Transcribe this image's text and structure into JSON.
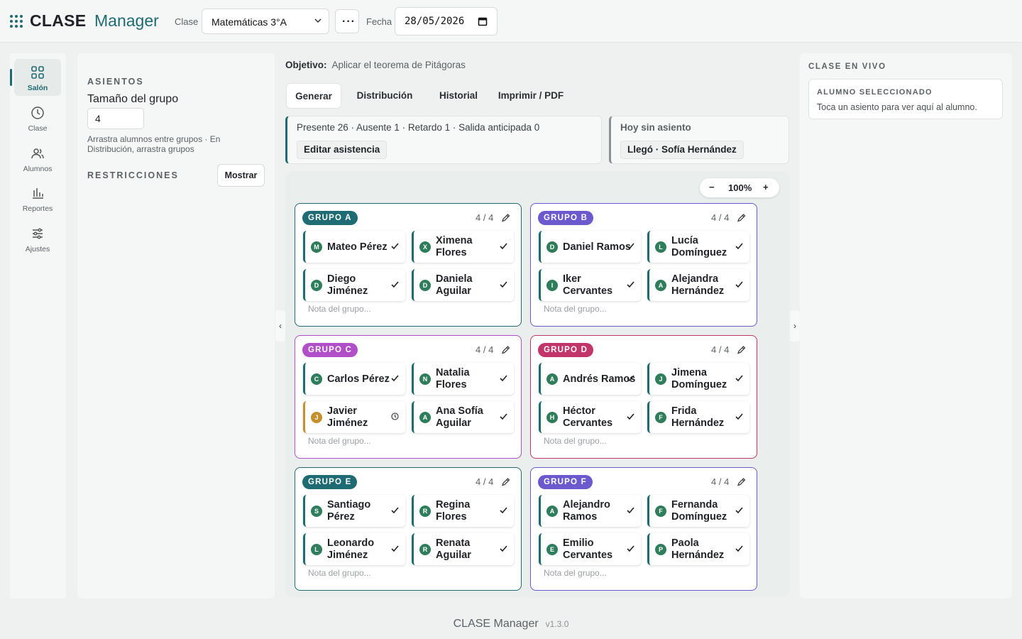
{
  "header": {
    "brand_bold": "CLASE",
    "brand_light": "Manager",
    "class_label": "Clase",
    "class_value": "Matemáticas 3°A",
    "more_icon": "more-horizontal-icon",
    "date_label": "Fecha",
    "date_value": "28/05/2026"
  },
  "nav": {
    "items": [
      {
        "label": "Salón",
        "icon": "grid-icon"
      },
      {
        "label": "Clase",
        "icon": "clock-icon"
      },
      {
        "label": "Alumnos",
        "icon": "users-icon"
      },
      {
        "label": "Reportes",
        "icon": "bar-chart-icon"
      },
      {
        "label": "Ajustes",
        "icon": "sliders-icon"
      }
    ]
  },
  "left_panel": {
    "seats_heading": "ASIENTOS",
    "group_size_label": "Tamaño del grupo",
    "group_size_value": "4",
    "hint": "Arrastra alumnos entre grupos · En Distribución, arrastra grupos",
    "restrictions_heading": "RESTRICCIONES",
    "show_button": "Mostrar"
  },
  "main": {
    "objective_label": "Objetivo:",
    "objective_text": "Aplicar el teorema de Pitágoras",
    "tabs": [
      "Generar",
      "Distribución",
      "Historial",
      "Imprimir / PDF"
    ],
    "active_tab": "Generar",
    "attendance": {
      "summary": "Presente 26 · Ausente 1 · Retardo 1 · Salida anticipada 0",
      "edit_button": "Editar asistencia"
    },
    "no_seat": {
      "title": "Hoy sin asiento",
      "chip": "Llegó · Sofía Hernández"
    },
    "zoom": {
      "minus": "−",
      "value": "100%",
      "plus": "+"
    },
    "edge_left": "‹",
    "edge_right": "›"
  },
  "groups": [
    {
      "name": "GRUPO A",
      "color": "#1e6b73",
      "count": "4 / 4",
      "note_placeholder": "Nota del grupo...",
      "seats": [
        {
          "initial": "M",
          "name": "Mateo Pérez",
          "status": "present"
        },
        {
          "initial": "X",
          "name": "Ximena Flores",
          "status": "present"
        },
        {
          "initial": "D",
          "name": "Diego Jiménez",
          "status": "present"
        },
        {
          "initial": "D",
          "name": "Daniela Aguilar",
          "status": "present"
        }
      ]
    },
    {
      "name": "GRUPO B",
      "color": "#6a5acd",
      "count": "4 / 4",
      "note_placeholder": "Nota del grupo...",
      "seats": [
        {
          "initial": "D",
          "name": "Daniel Ramos",
          "status": "present"
        },
        {
          "initial": "L",
          "name": "Lucía Domínguez",
          "status": "present"
        },
        {
          "initial": "I",
          "name": "Iker Cervantes",
          "status": "present"
        },
        {
          "initial": "A",
          "name": "Alejandra Hernández",
          "status": "present"
        }
      ]
    },
    {
      "name": "GRUPO C",
      "color": "#b04fc7",
      "count": "4 / 4",
      "note_placeholder": "Nota del grupo...",
      "seats": [
        {
          "initial": "C",
          "name": "Carlos Pérez",
          "status": "present"
        },
        {
          "initial": "N",
          "name": "Natalia Flores",
          "status": "present"
        },
        {
          "initial": "J",
          "name": "Javier Jiménez",
          "status": "late"
        },
        {
          "initial": "A",
          "name": "Ana Sofía Aguilar",
          "status": "present"
        }
      ]
    },
    {
      "name": "GRUPO D",
      "color": "#c2356b",
      "count": "4 / 4",
      "note_placeholder": "Nota del grupo...",
      "seats": [
        {
          "initial": "A",
          "name": "Andrés Ramos",
          "status": "present"
        },
        {
          "initial": "J",
          "name": "Jimena Domínguez",
          "status": "present"
        },
        {
          "initial": "H",
          "name": "Héctor Cervantes",
          "status": "present"
        },
        {
          "initial": "F",
          "name": "Frida Hernández",
          "status": "present"
        }
      ]
    },
    {
      "name": "GRUPO E",
      "color": "#1e6b73",
      "count": "4 / 4",
      "note_placeholder": "Nota del grupo...",
      "seats": [
        {
          "initial": "S",
          "name": "Santiago Pérez",
          "status": "present"
        },
        {
          "initial": "R",
          "name": "Regina Flores",
          "status": "present"
        },
        {
          "initial": "L",
          "name": "Leonardo Jiménez",
          "status": "present"
        },
        {
          "initial": "R",
          "name": "Renata Aguilar",
          "status": "present"
        }
      ]
    },
    {
      "name": "GRUPO F",
      "color": "#6a5acd",
      "count": "4 / 4",
      "note_placeholder": "Nota del grupo...",
      "seats": [
        {
          "initial": "A",
          "name": "Alejandro Ramos",
          "status": "present"
        },
        {
          "initial": "F",
          "name": "Fernanda Domínguez",
          "status": "present"
        },
        {
          "initial": "E",
          "name": "Emilio Cervantes",
          "status": "present"
        },
        {
          "initial": "P",
          "name": "Paola Hernández",
          "status": "present"
        }
      ]
    }
  ],
  "right_panel": {
    "heading": "CLASE EN VIVO",
    "card_heading": "ALUMNO SELECCIONADO",
    "card_text": "Toca un asiento para ver aquí al alumno."
  },
  "footer": {
    "app": "CLASE Manager",
    "version": "v1.3.0"
  }
}
